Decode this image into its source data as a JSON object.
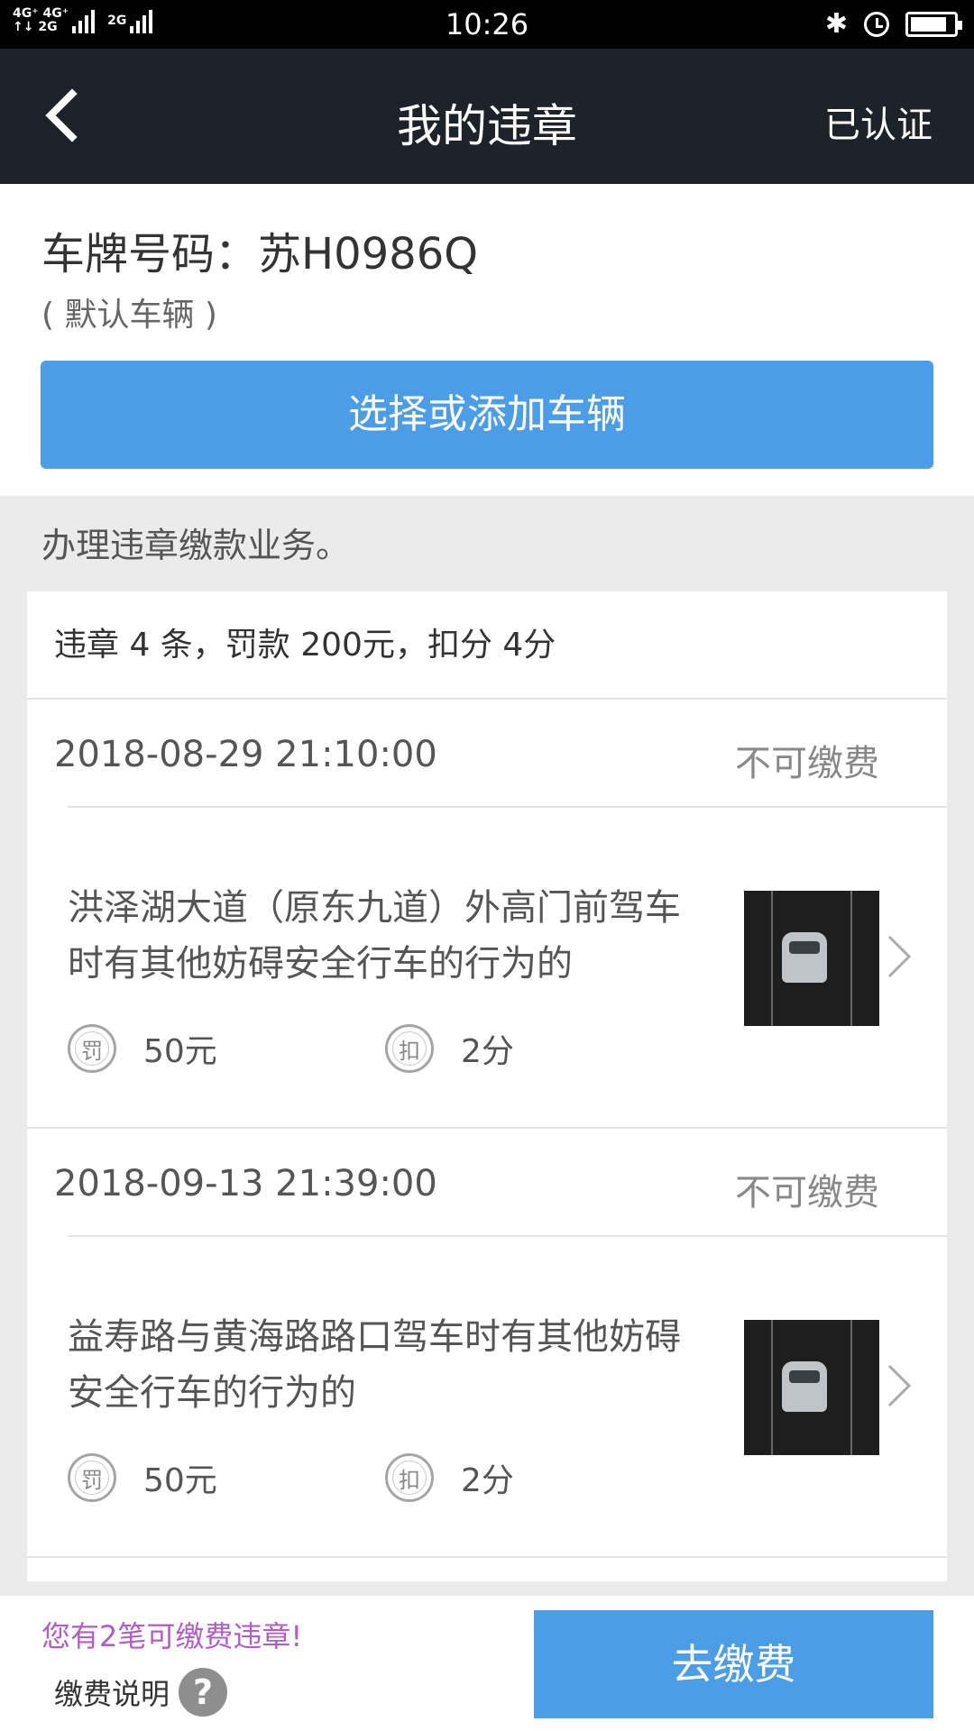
{
  "status_bar": {
    "network_top": "4G⁺ 4G⁺",
    "network_bottom": "↑↓ 2G",
    "network_extra": "2G",
    "time": "10:26",
    "battery_level": 0.85
  },
  "nav": {
    "title": "我的违章",
    "right_label": "已认证",
    "back_icon": "chevron-left-icon"
  },
  "vehicle": {
    "plate_line": "车牌号码：苏H0986Q",
    "default_tag": "( 默认车辆 )",
    "select_button": "选择或添加车辆"
  },
  "notice_text": "办理违章缴款业务。",
  "summary": "违章 4 条，罚款 200元，扣分 4分",
  "violations": [
    {
      "datetime": "2018-08-29 21:10:00",
      "status": "不可缴费",
      "description": "洪泽湖大道（原东九道）外高门前驾车时有其他妨碍安全行车的行为的",
      "fine_icon": "罚",
      "fine": "50元",
      "points_icon": "扣",
      "points": "2分"
    },
    {
      "datetime": "2018-09-13 21:39:00",
      "status": "不可缴费",
      "description": "益寿路与黄海路路口驾车时有其他妨碍安全行车的行为的",
      "fine_icon": "罚",
      "fine": "50元",
      "points_icon": "扣",
      "points": "2分"
    }
  ],
  "bottom": {
    "payable_note": "您有2笔可缴费违章!",
    "explain_label": "缴费说明",
    "help_icon": "?",
    "pay_button": "去缴费"
  },
  "colors": {
    "nav_bg": "#1c232b",
    "accent": "#4a9de6",
    "note": "#b05cc9"
  }
}
